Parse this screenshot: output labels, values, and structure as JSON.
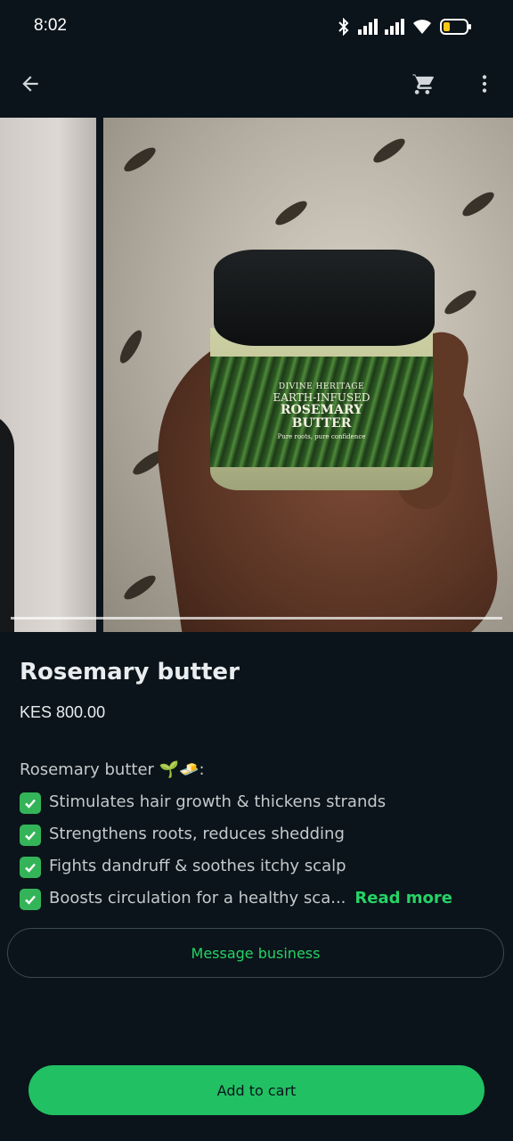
{
  "status_bar": {
    "time": "8:02",
    "icons": [
      "bluetooth-icon",
      "signal-icon",
      "signal-icon",
      "wifi-icon",
      "battery-icon"
    ],
    "battery_color": "#f6c90e"
  },
  "app_bar": {
    "back_icon": "arrow-back-icon",
    "cart_icon": "cart-icon",
    "more_icon": "more-vert-icon"
  },
  "product_image": {
    "brand": "DIVINE HERITAGE",
    "line": "EARTH-INFUSED",
    "name_1": "ROSEMARY",
    "name_2": "BUTTER",
    "tagline": "Pure roots, pure confidence"
  },
  "product": {
    "title": "Rosemary butter",
    "price": "KES 800.00"
  },
  "description": {
    "intro": "Rosemary butter 🌱🧈:",
    "bullets": [
      "Stimulates hair growth & thickens strands",
      "Strengthens roots, reduces shedding",
      "Fights dandruff & soothes itchy scalp",
      "Boosts circulation for a healthy sca..."
    ],
    "read_more": "Read more"
  },
  "actions": {
    "message_business": "Message business",
    "add_to_cart": "Add to cart"
  },
  "colors": {
    "background": "#0b141a",
    "accent": "#25d366",
    "button_fill": "#21c063"
  }
}
